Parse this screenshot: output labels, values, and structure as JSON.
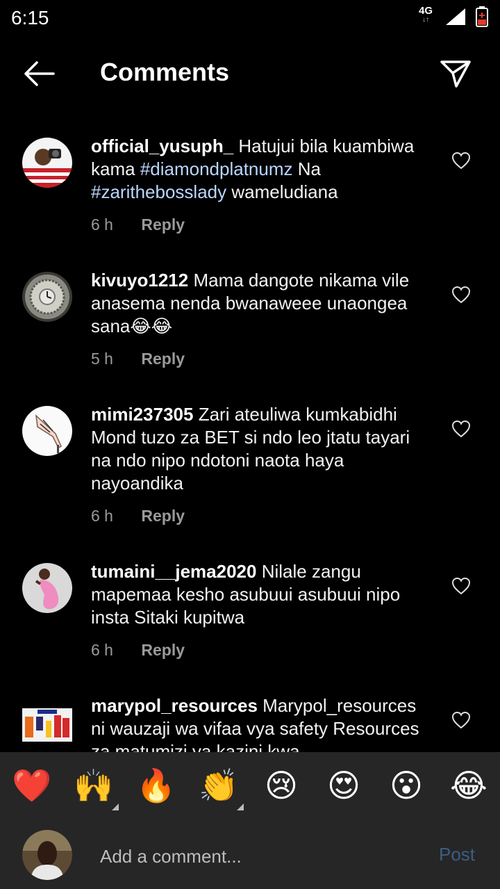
{
  "status_bar": {
    "time": "6:15",
    "network": "4G"
  },
  "header": {
    "title": "Comments"
  },
  "comments": [
    {
      "username": "official_yusuph_",
      "text_1": "Hatujui bila kuambiwa kama",
      "tag_1": "#diamondplatnumz",
      "text_2": "Na",
      "tag_2": "#zarithebosslady",
      "text_3": "wameludiana",
      "time": "6 h",
      "reply": "Reply"
    },
    {
      "username": "kivuyo1212",
      "text": "Mama dangote nikama vile anasema nenda bwanaweee unaongea sana😂😂",
      "time": "5 h",
      "reply": "Reply"
    },
    {
      "username": "mimi237305",
      "text": "Zari ateuliwa kumkabidhi Mond tuzo za BET si ndo leo jtatu tayari na ndo nipo ndotoni naota haya nayoandika",
      "time": "6 h",
      "reply": "Reply"
    },
    {
      "username": "tumaini__jema2020",
      "text": "Nilale zangu mapemaa kesho asubuui asubuui nipo insta Sitaki kupitwa",
      "time": "6 h",
      "reply": "Reply"
    },
    {
      "username": "marypol_resources",
      "text": "Marypol_resources ni wauzaji wa vifaa vya safety Resources za matumizi ya kazini kwa"
    }
  ],
  "reactions": [
    {
      "emoji": "❤️",
      "name": "red-heart"
    },
    {
      "emoji": "🙌",
      "name": "raising-hands"
    },
    {
      "emoji": "🔥",
      "name": "fire"
    },
    {
      "emoji": "👏",
      "name": "clapping-hands"
    },
    {
      "emoji": "😢",
      "name": "crying-face"
    },
    {
      "emoji": "😍",
      "name": "heart-eyes"
    },
    {
      "emoji": "😮",
      "name": "surprised-face"
    },
    {
      "emoji": "😂",
      "name": "tears-of-joy"
    }
  ],
  "composer": {
    "placeholder": "Add a comment...",
    "post_label": "Post"
  },
  "colors": {
    "background": "#000000",
    "panel": "#262626",
    "hashtag": "#b9d6ff",
    "post_disabled": "#3a5e86",
    "meta": "#9a9a9a"
  }
}
